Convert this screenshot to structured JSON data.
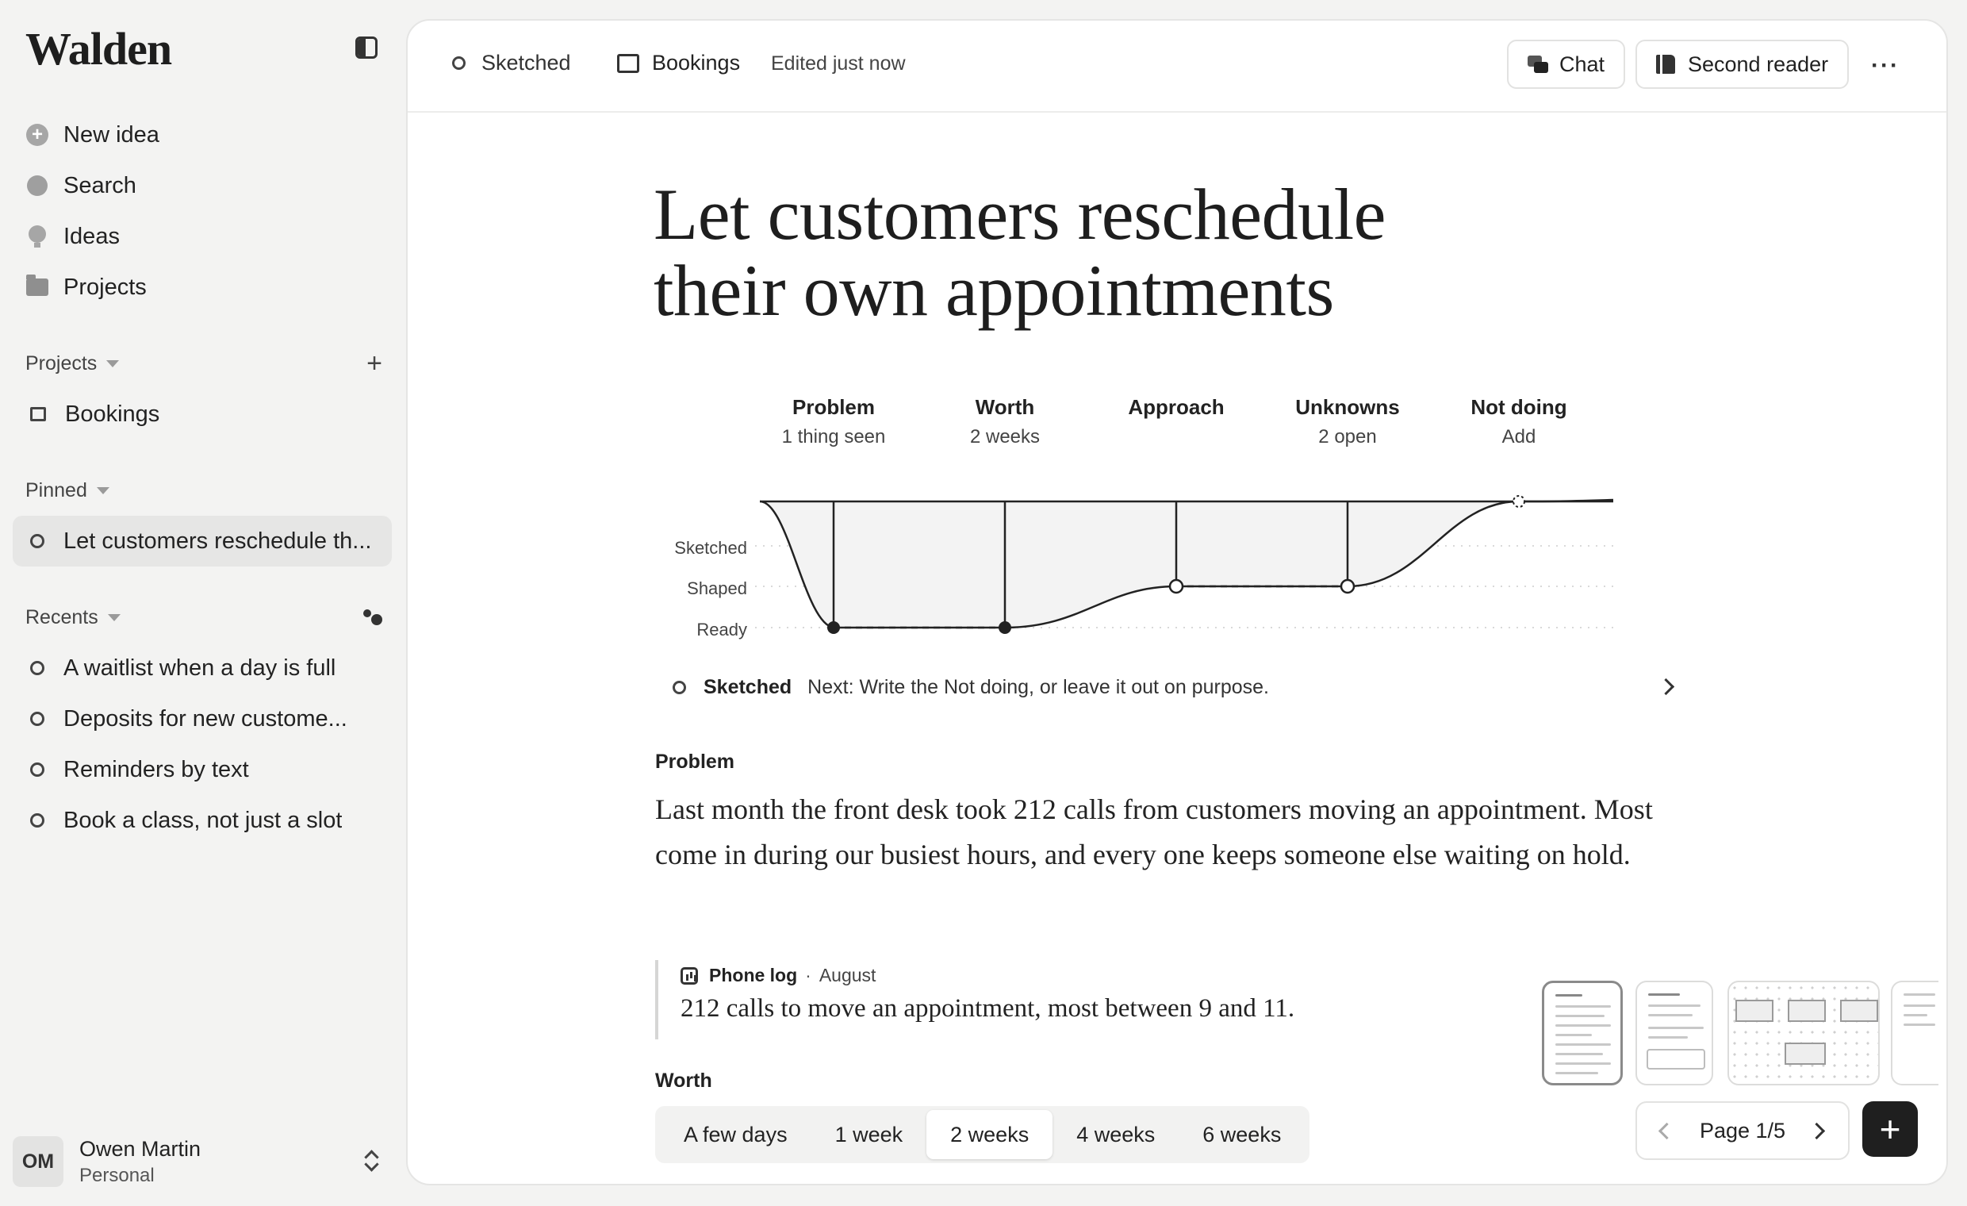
{
  "sidebar": {
    "logo": "Walden",
    "nav": [
      {
        "label": "New idea",
        "icon": "plus-circle-icon"
      },
      {
        "label": "Search",
        "icon": "search-icon"
      },
      {
        "label": "Ideas",
        "icon": "lightbulb-icon"
      },
      {
        "label": "Projects",
        "icon": "folder-icon"
      }
    ],
    "projects_heading": "Projects",
    "projects": [
      {
        "label": "Bookings"
      }
    ],
    "pinned_heading": "Pinned",
    "pinned": [
      {
        "label": "Let customers reschedule th..."
      }
    ],
    "recents_heading": "Recents",
    "recents": [
      {
        "label": "A waitlist when a day is full"
      },
      {
        "label": "Deposits for new custome..."
      },
      {
        "label": "Reminders by text"
      },
      {
        "label": "Book a class, not just a slot"
      }
    ],
    "user": {
      "initials": "OM",
      "name": "Owen Martin",
      "workspace": "Personal"
    }
  },
  "topbar": {
    "status": "Sketched",
    "project": "Bookings",
    "edited": "Edited just now",
    "chat_label": "Chat",
    "second_reader_label": "Second reader",
    "more_label": "···"
  },
  "doc": {
    "title_line1": "Let customers reschedule",
    "title_line2": "their own appointments",
    "stages": [
      {
        "name": "Problem",
        "meta": "1 thing seen",
        "level": "Ready",
        "marker": "filled"
      },
      {
        "name": "Worth",
        "meta": "2 weeks",
        "level": "Ready",
        "marker": "filled"
      },
      {
        "name": "Approach",
        "meta": "",
        "level": "Shaped",
        "marker": "open"
      },
      {
        "name": "Unknowns",
        "meta": "2 open",
        "level": "Shaped",
        "marker": "open"
      },
      {
        "name": "Not doing",
        "meta": "Add",
        "level": "Baseline",
        "marker": "dashed"
      }
    ],
    "levels": [
      "Sketched",
      "Shaped",
      "Ready"
    ],
    "next_status": "Sketched",
    "next_text": "Next: Write the Not doing, or leave it out on purpose.",
    "problem_label": "Problem",
    "problem_text": "Last month the front desk took 212 calls from customers moving an appointment. Most come in during our busiest hours, and every one keeps someone else waiting on hold.",
    "evidence": {
      "source": "Phone log",
      "sep": "·",
      "date": "August",
      "text": "212 calls to move an appointment, most between 9 and 11."
    },
    "worth_label": "Worth",
    "worth_options": [
      "A few days",
      "1 week",
      "2 weeks",
      "4 weeks",
      "6 weeks"
    ],
    "worth_selected": "2 weeks",
    "pager": "Page 1/5",
    "fab": "+"
  }
}
